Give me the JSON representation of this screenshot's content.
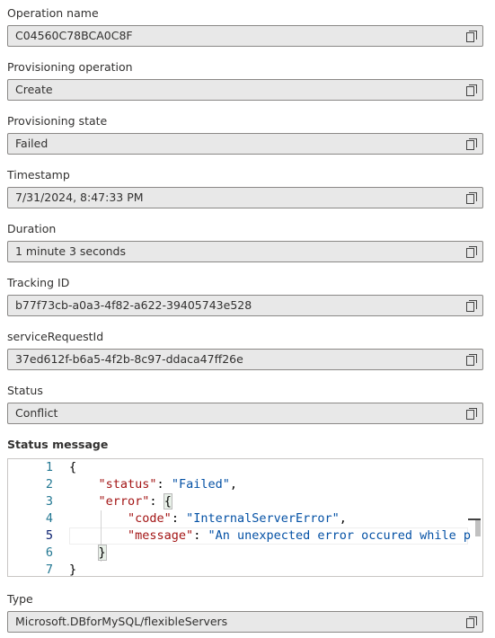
{
  "fields": [
    {
      "label": "Operation name",
      "value": "C04560C78BCA0C8F"
    },
    {
      "label": "Provisioning operation",
      "value": "Create"
    },
    {
      "label": "Provisioning state",
      "value": "Failed"
    },
    {
      "label": "Timestamp",
      "value": "7/31/2024, 8:47:33 PM"
    },
    {
      "label": "Duration",
      "value": "1 minute 3 seconds"
    },
    {
      "label": "Tracking ID",
      "value": "b77f73cb-a0a3-4f82-a622-39405743e528"
    },
    {
      "label": "serviceRequestId",
      "value": "37ed612f-b6a5-4f2b-8c97-ddaca47ff26e"
    },
    {
      "label": "Status",
      "value": "Conflict"
    }
  ],
  "status_message": {
    "label": "Status message",
    "line_numbers": [
      "1",
      "2",
      "3",
      "4",
      "5",
      "6",
      "7"
    ],
    "code": {
      "open_brace": "{",
      "status_key": "\"status\"",
      "status_value": "\"Failed\"",
      "error_key": "\"error\"",
      "code_key": "\"code\"",
      "code_value": "\"InternalServerError\"",
      "message_key": "\"message\"",
      "message_value": "\"An unexpected error occured while p",
      "close_inner": "}",
      "close_outer": "}"
    }
  },
  "type_field": {
    "label": "Type",
    "value": "Microsoft.DBforMySQL/flexibleServers"
  },
  "icons": {
    "copy": "copy-icon"
  }
}
